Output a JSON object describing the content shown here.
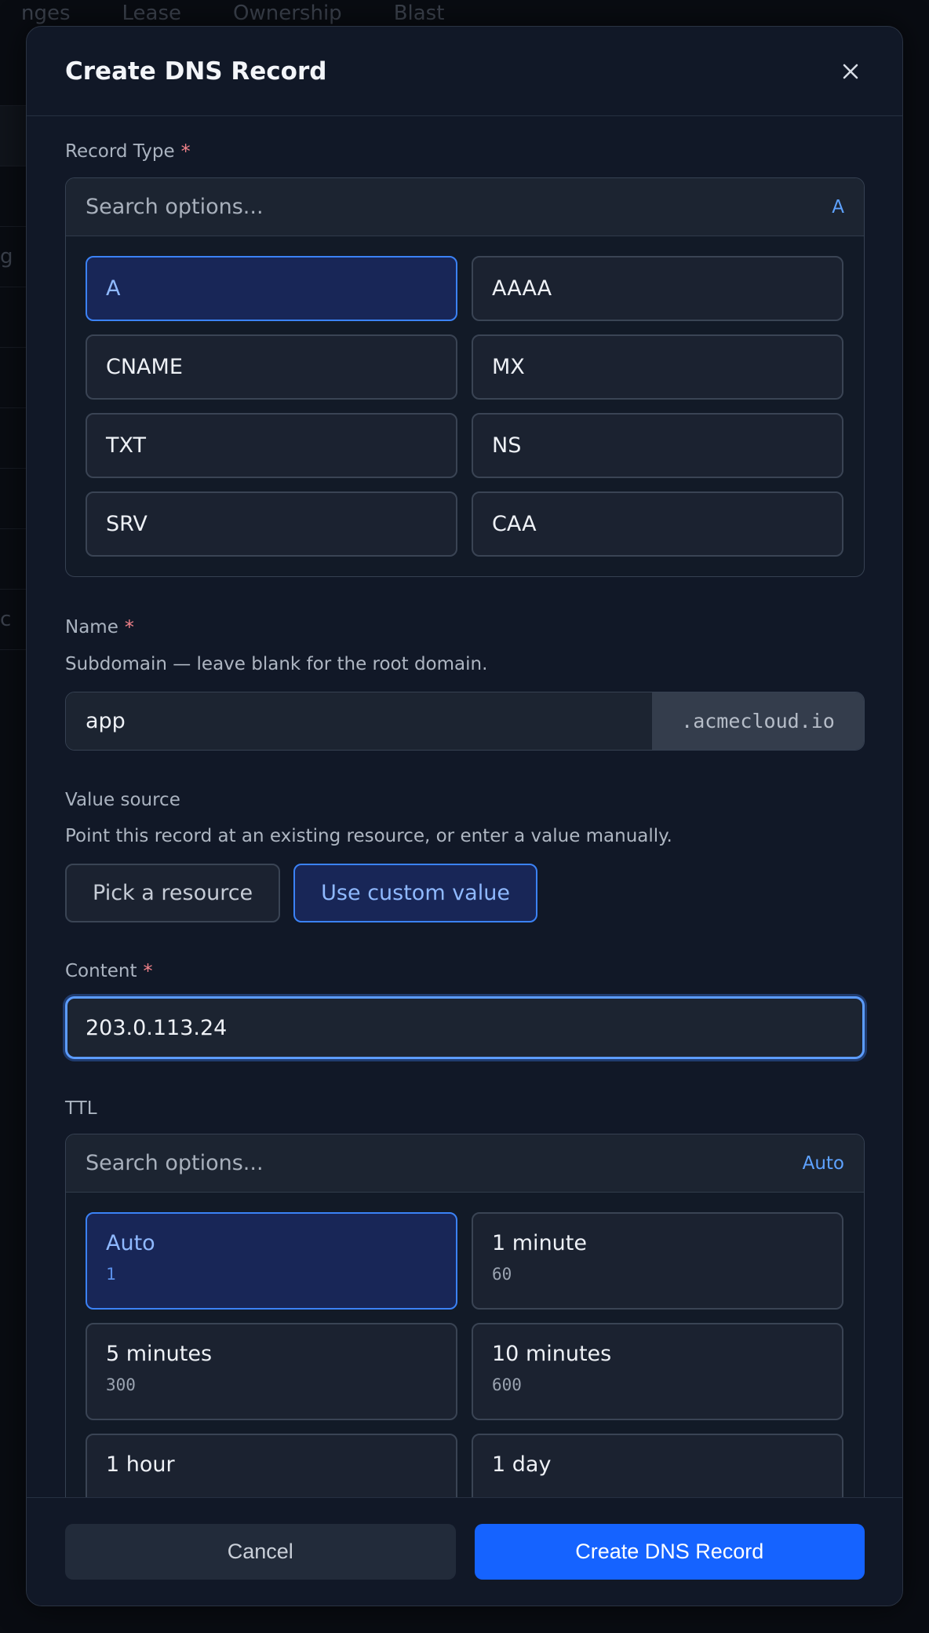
{
  "background": {
    "tabs": [
      "nges",
      "Lease",
      "Ownership",
      "Blast"
    ],
    "row_fragments": [
      "",
      "",
      "",
      "g",
      "",
      "",
      "",
      "",
      "",
      "c"
    ]
  },
  "modal": {
    "title": "Create DNS Record",
    "close_icon": "close-icon",
    "record_type": {
      "label": "Record Type",
      "required_mark": "*",
      "search_placeholder": "Search options...",
      "selected_value": "A",
      "options": [
        "A",
        "AAAA",
        "CNAME",
        "MX",
        "TXT",
        "NS",
        "SRV",
        "CAA"
      ],
      "selected_index": 0
    },
    "name": {
      "label": "Name",
      "required_mark": "*",
      "help": "Subdomain — leave blank for the root domain.",
      "value": "app",
      "suffix": ".acmecloud.io"
    },
    "value_source": {
      "label": "Value source",
      "help": "Point this record at an existing resource, or enter a value manually.",
      "options": [
        "Pick a resource",
        "Use custom value"
      ],
      "active_index": 1
    },
    "content": {
      "label": "Content",
      "required_mark": "*",
      "value": "203.0.113.24"
    },
    "ttl": {
      "label": "TTL",
      "search_placeholder": "Search options...",
      "selected_value": "Auto",
      "options": [
        {
          "label": "Auto",
          "value": "1"
        },
        {
          "label": "1 minute",
          "value": "60"
        },
        {
          "label": "5 minutes",
          "value": "300"
        },
        {
          "label": "10 minutes",
          "value": "600"
        },
        {
          "label": "1 hour",
          "value": ""
        },
        {
          "label": "1 day",
          "value": ""
        }
      ],
      "selected_index": 0
    },
    "footer": {
      "cancel_label": "Cancel",
      "submit_label": "Create DNS Record"
    },
    "colors": {
      "accent": "#3b82f6",
      "primary_button": "#1563ff",
      "selected_bg": "#182657",
      "required": "#f08189"
    }
  }
}
